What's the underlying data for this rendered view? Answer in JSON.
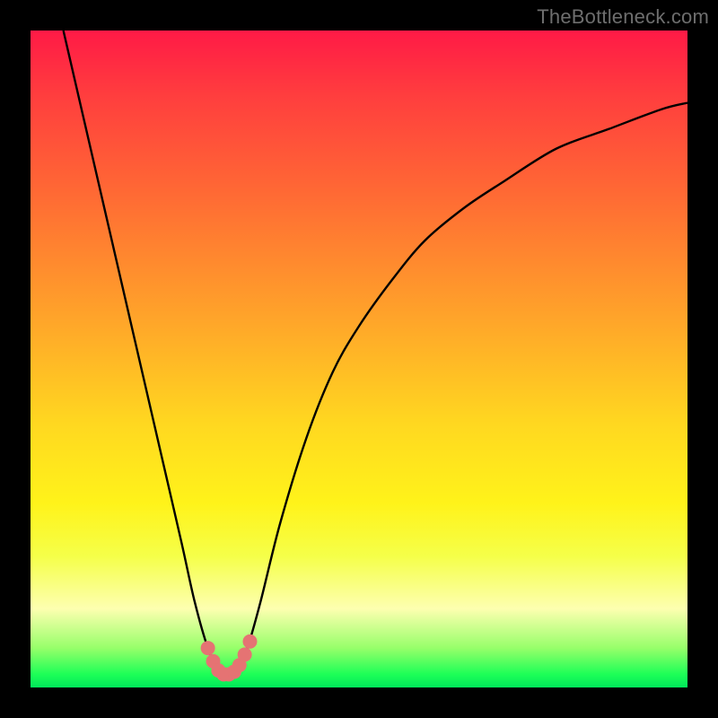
{
  "watermark": {
    "text": "TheBottleneck.com"
  },
  "chart_data": {
    "type": "line",
    "title": "",
    "xlabel": "",
    "ylabel": "",
    "xlim": [
      0,
      100
    ],
    "ylim": [
      0,
      100
    ],
    "series": [
      {
        "name": "curve",
        "x": [
          5,
          8,
          11,
          14,
          17,
          20,
          23,
          25,
          27,
          28.5,
          30,
          31.5,
          33,
          35,
          38,
          42,
          46,
          50,
          55,
          60,
          66,
          72,
          80,
          88,
          96,
          100
        ],
        "y": [
          100,
          87,
          74,
          61,
          48,
          35,
          22,
          13,
          6,
          3,
          2,
          3,
          6,
          13,
          25,
          38,
          48,
          55,
          62,
          68,
          73,
          77,
          82,
          85,
          88,
          89
        ]
      }
    ],
    "markers": {
      "name": "trough-dots",
      "color": "#e57373",
      "points": [
        {
          "x": 27.0,
          "y": 6.0
        },
        {
          "x": 27.8,
          "y": 4.0
        },
        {
          "x": 28.6,
          "y": 2.6
        },
        {
          "x": 29.4,
          "y": 2.0
        },
        {
          "x": 30.2,
          "y": 2.0
        },
        {
          "x": 31.0,
          "y": 2.4
        },
        {
          "x": 31.8,
          "y": 3.4
        },
        {
          "x": 32.6,
          "y": 5.0
        },
        {
          "x": 33.4,
          "y": 7.0
        }
      ]
    },
    "colors": {
      "curve": "#000000",
      "marker": "#e57373",
      "gradient_top": "#ff1a46",
      "gradient_bottom": "#00e85a",
      "frame": "#000000"
    }
  }
}
